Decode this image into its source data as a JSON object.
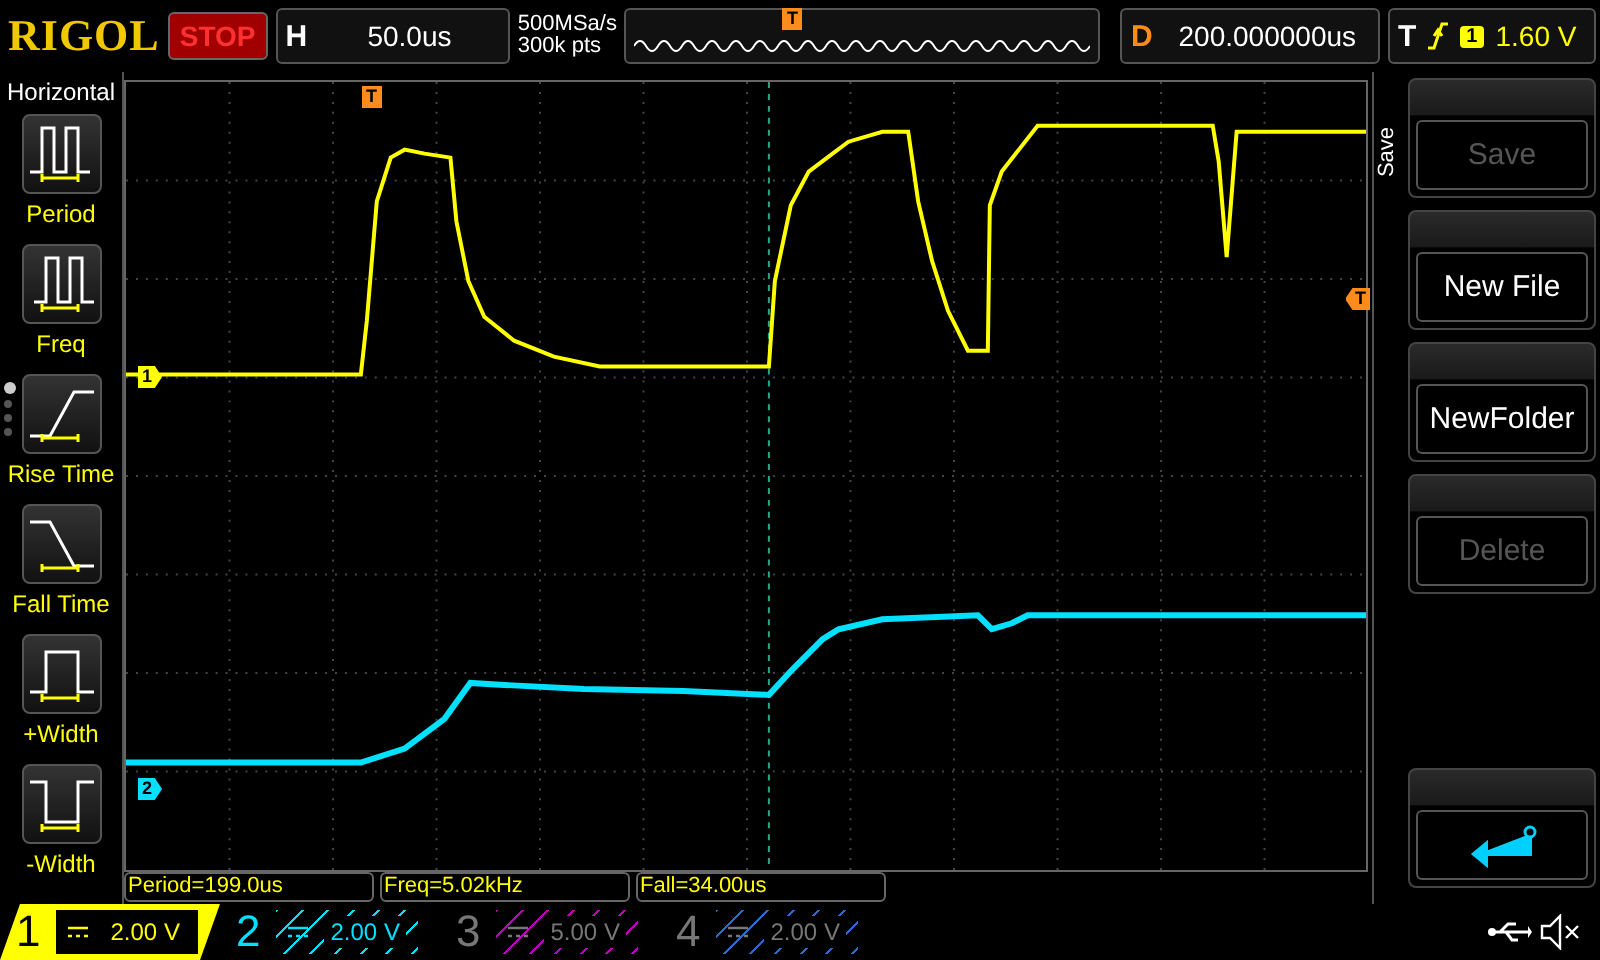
{
  "brand": "RIGOL",
  "run_state": "STOP",
  "horizontal": {
    "label": "H",
    "timebase": "50.0us"
  },
  "acquisition": {
    "sample_rate": "500MSa/s",
    "memory_depth": "300k pts"
  },
  "trigger_position_marker": "T",
  "delay": {
    "label": "D",
    "value": "200.000000us"
  },
  "trigger": {
    "label": "T",
    "source": "1",
    "level": "1.60 V"
  },
  "left_menu": {
    "title": "Horizontal",
    "items": [
      {
        "label": "Period",
        "kind": "period"
      },
      {
        "label": "Freq",
        "kind": "freq"
      },
      {
        "label": "Rise Time",
        "kind": "rise"
      },
      {
        "label": "Fall Time",
        "kind": "fall"
      },
      {
        "label": "+Width",
        "kind": "pwidth"
      },
      {
        "label": "-Width",
        "kind": "nwidth"
      }
    ],
    "pages": [
      {
        "selected": true
      },
      {
        "selected": false
      },
      {
        "selected": false
      },
      {
        "selected": false
      }
    ]
  },
  "screen_markers": {
    "channel_1": "1",
    "channel_2": "2",
    "trigger_level": "T",
    "trigger_time": "T"
  },
  "measurements": [
    "Period=199.0us",
    "Freq=5.02kHz",
    "Fall=34.00us"
  ],
  "right_menu": {
    "title": "Save",
    "buttons": [
      {
        "label": "Save",
        "disabled": true
      },
      {
        "label": "New File",
        "disabled": false
      },
      {
        "label": "NewFolder",
        "disabled": false
      },
      {
        "label": "Delete",
        "disabled": true
      }
    ]
  },
  "channels": [
    {
      "number": "1",
      "scale": "2.00 V",
      "on": true,
      "selected": true,
      "color": "#ffff00"
    },
    {
      "number": "2",
      "scale": "2.00 V",
      "on": true,
      "selected": false,
      "color": "#00e0ff"
    },
    {
      "number": "3",
      "scale": "5.00 V",
      "on": false,
      "selected": false,
      "color": "#c000c0"
    },
    {
      "number": "4",
      "scale": "2.00 V",
      "on": false,
      "selected": false,
      "color": "#2a6ad0"
    }
  ]
}
